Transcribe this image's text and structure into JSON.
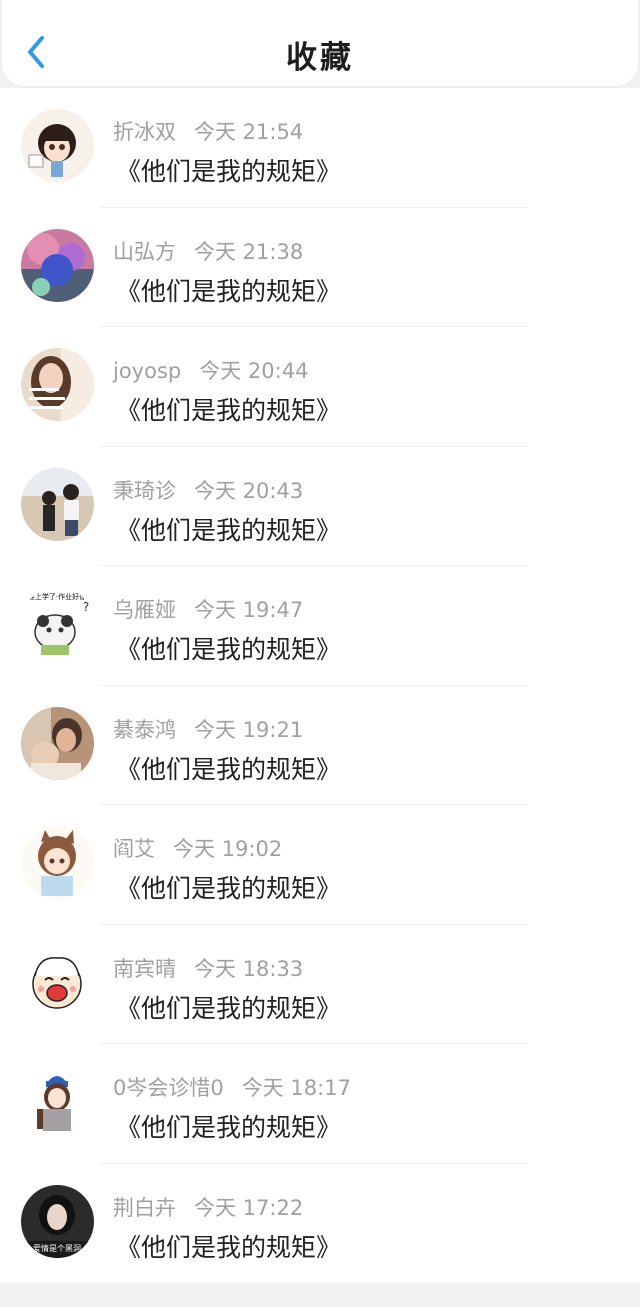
{
  "header": {
    "title": "收藏",
    "back_icon": "chevron-left-icon",
    "accent_color": "#2d9be4"
  },
  "items": [
    {
      "name": "折冰双",
      "time": "今天 21:54",
      "content": "《他们是我的规矩》"
    },
    {
      "name": "山弘方",
      "time": "今天 21:38",
      "content": "《他们是我的规矩》"
    },
    {
      "name": "joyosp",
      "time": "今天 20:44",
      "content": "《他们是我的规矩》"
    },
    {
      "name": "秉琦诊",
      "time": "今天 20:43",
      "content": "《他们是我的规矩》"
    },
    {
      "name": "乌雁娅",
      "time": "今天 19:47",
      "content": "《他们是我的规矩》"
    },
    {
      "name": "綦泰鸿",
      "time": "今天 19:21",
      "content": "《他们是我的规矩》"
    },
    {
      "name": "阎艾",
      "time": "今天 19:02",
      "content": "《他们是我的规矩》"
    },
    {
      "name": "南宾晴",
      "time": "今天 18:33",
      "content": "《他们是我的规矩》"
    },
    {
      "name": "0岑会诊惜0",
      "time": "今天 18:17",
      "content": "《他们是我的规矩》"
    },
    {
      "name": "荆白卉",
      "time": "今天 17:22",
      "content": "《他们是我的规矩》"
    }
  ],
  "avatar_texts": {
    "item_5": "今天要上学了·作业好像还没",
    "item_10": "爱情是个黑洞"
  }
}
